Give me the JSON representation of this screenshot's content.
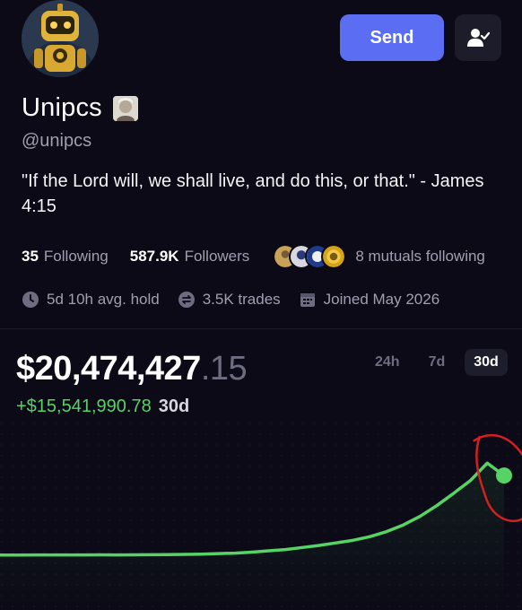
{
  "profile": {
    "display_name": "Unipcs",
    "handle": "@unipcs",
    "bio": "\"If the Lord will, we shall live, and do this, or that.\" - James 4:15",
    "avatar_icon": "robot-avatar-icon",
    "badge_icon": "portrait-badge-icon"
  },
  "actions": {
    "send_label": "Send",
    "follow_icon": "user-check-icon"
  },
  "stats": {
    "following_count": "35",
    "following_label": "Following",
    "followers_count": "587.9K",
    "followers_label": "Followers",
    "mutuals_label": "8 mutuals following"
  },
  "meta": {
    "avg_hold": "5d 10h avg. hold",
    "trades": "3.5K trades",
    "joined": "Joined May 2026"
  },
  "portfolio": {
    "value_int": "$20,474,427",
    "value_dec": ".15",
    "change": "+$15,541,990.78",
    "change_period": "30d"
  },
  "ranges": {
    "items": [
      "24h",
      "7d",
      "30d"
    ],
    "active": "30d"
  },
  "colors": {
    "background": "#0b0a16",
    "accent": "#5b6ef3",
    "positive": "#56d364",
    "annotation": "#d32020"
  },
  "chart_data": {
    "type": "line",
    "x": [
      0,
      1,
      2,
      3,
      4,
      5,
      6,
      7,
      8,
      9,
      10,
      11,
      12,
      13,
      14,
      15,
      16,
      17,
      18,
      19,
      20,
      21,
      22,
      23,
      24,
      25,
      26,
      27,
      28,
      29,
      30
    ],
    "values": [
      4.93,
      4.93,
      4.94,
      4.95,
      4.94,
      4.95,
      4.96,
      4.95,
      4.97,
      4.98,
      5.0,
      5.05,
      5.1,
      5.2,
      5.3,
      5.5,
      5.75,
      6.0,
      6.4,
      6.8,
      7.3,
      7.8,
      8.5,
      9.5,
      10.8,
      12.5,
      14.6,
      17.0,
      19.5,
      22.9,
      20.47
    ],
    "series_unit": "$M",
    "title": "",
    "xlabel": "",
    "ylabel": "",
    "grid": false
  }
}
